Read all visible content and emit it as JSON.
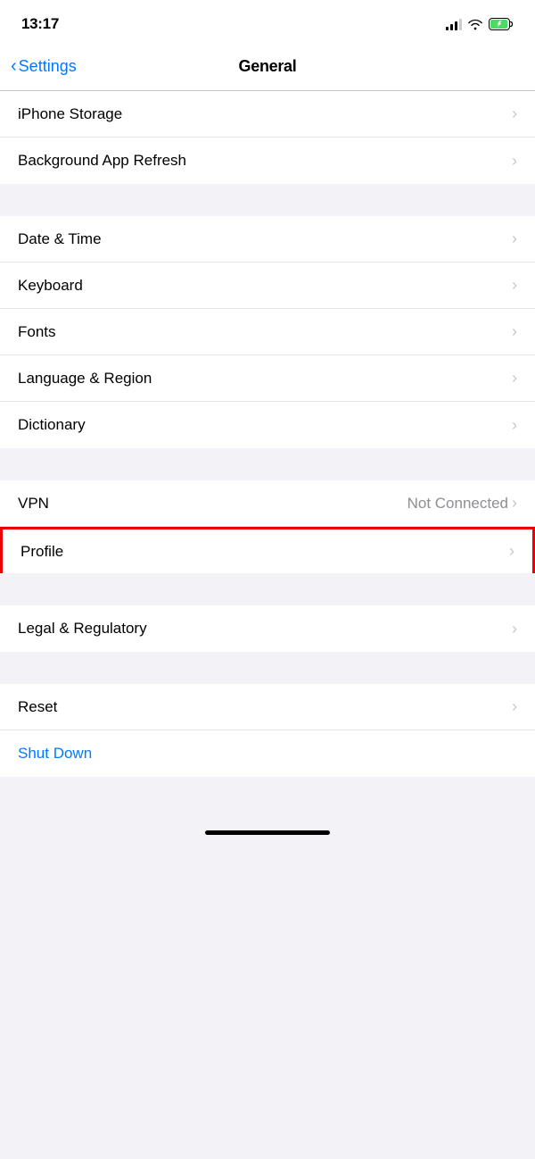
{
  "statusBar": {
    "time": "13:17"
  },
  "navBar": {
    "backLabel": "Settings",
    "title": "General"
  },
  "sections": [
    {
      "id": "storage-refresh",
      "rows": [
        {
          "id": "iphone-storage",
          "label": "iPhone Storage",
          "value": "",
          "chevron": true
        },
        {
          "id": "background-app-refresh",
          "label": "Background App Refresh",
          "value": "",
          "chevron": true
        }
      ]
    },
    {
      "id": "datetime-section",
      "rows": [
        {
          "id": "date-time",
          "label": "Date & Time",
          "value": "",
          "chevron": true
        },
        {
          "id": "keyboard",
          "label": "Keyboard",
          "value": "",
          "chevron": true
        },
        {
          "id": "fonts",
          "label": "Fonts",
          "value": "",
          "chevron": true
        },
        {
          "id": "language-region",
          "label": "Language & Region",
          "value": "",
          "chevron": true
        },
        {
          "id": "dictionary",
          "label": "Dictionary",
          "value": "",
          "chevron": true
        }
      ]
    },
    {
      "id": "vpn-section",
      "rows": [
        {
          "id": "vpn",
          "label": "VPN",
          "value": "Not Connected",
          "chevron": true
        },
        {
          "id": "profile",
          "label": "Profile",
          "value": "",
          "chevron": true,
          "highlighted": true
        }
      ]
    },
    {
      "id": "legal-section",
      "rows": [
        {
          "id": "legal-regulatory",
          "label": "Legal & Regulatory",
          "value": "",
          "chevron": true
        }
      ]
    },
    {
      "id": "reset-section",
      "rows": [
        {
          "id": "reset",
          "label": "Reset",
          "value": "",
          "chevron": true
        },
        {
          "id": "shut-down",
          "label": "Shut Down",
          "value": "",
          "chevron": false,
          "blue": true
        }
      ]
    }
  ]
}
